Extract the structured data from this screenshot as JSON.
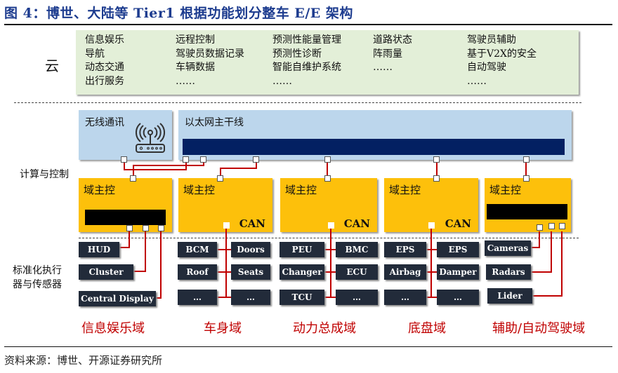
{
  "title": "图 4：博世、大陆等 Tier1 根据功能划分整车 E/E 架构",
  "cloud": {
    "label": "云",
    "columns": [
      [
        "信息娱乐",
        "导航",
        "动态交通",
        "出行服务"
      ],
      [
        "远程控制",
        "驾驶员数据记录",
        "车辆数据",
        "……"
      ],
      [
        "预测性能量管理",
        "预测性诊断",
        "智能自维护系统",
        "……"
      ],
      [
        "道路状态",
        "阵雨量",
        "……"
      ],
      [
        "驾驶员辅助",
        "基于V2X的安全",
        "自动驾驶",
        "……"
      ]
    ]
  },
  "sections": {
    "compute": "计算与控制",
    "actuator_line1": "标准化执行",
    "actuator_line2": "器与传感器"
  },
  "wireless": {
    "label": "无线通讯",
    "icon": "wifi-router-icon"
  },
  "ethernet": {
    "label": "以太网主干线"
  },
  "controllers": [
    {
      "label": "域主控",
      "bus": ""
    },
    {
      "label": "域主控",
      "bus": "CAN"
    },
    {
      "label": "域主控",
      "bus": "CAN"
    },
    {
      "label": "域主控",
      "bus": "CAN"
    },
    {
      "label": "域主控",
      "bus": ""
    }
  ],
  "devices": {
    "infotainment": [
      "HUD",
      "Cluster",
      "Central Display"
    ],
    "body": [
      "BCM",
      "Doors",
      "Roof",
      "Seats",
      "…",
      "…"
    ],
    "powertrain": [
      "PEU",
      "BMC",
      "Changer",
      "ECU",
      "TCU",
      "…"
    ],
    "chassis": [
      "EPS",
      "EPS",
      "Airbag",
      "Damper",
      "…",
      "…"
    ],
    "adas": [
      "Cameras",
      "Radars",
      "Lider"
    ]
  },
  "domains": [
    "信息娱乐域",
    "车身域",
    "动力总成域",
    "底盘域",
    "辅助/自动驾驶域"
  ],
  "source": "资料来源：博世、开源证券研究所",
  "colors": {
    "title": "#1d3c8f",
    "cloud_bg": "#e3efd8",
    "network_bg": "#bcd6ec",
    "ethernet_bar": "#032062",
    "controller": "#fdc00b",
    "device": "#222b3a",
    "wire": "#c00000",
    "domain_text": "#c00000"
  }
}
